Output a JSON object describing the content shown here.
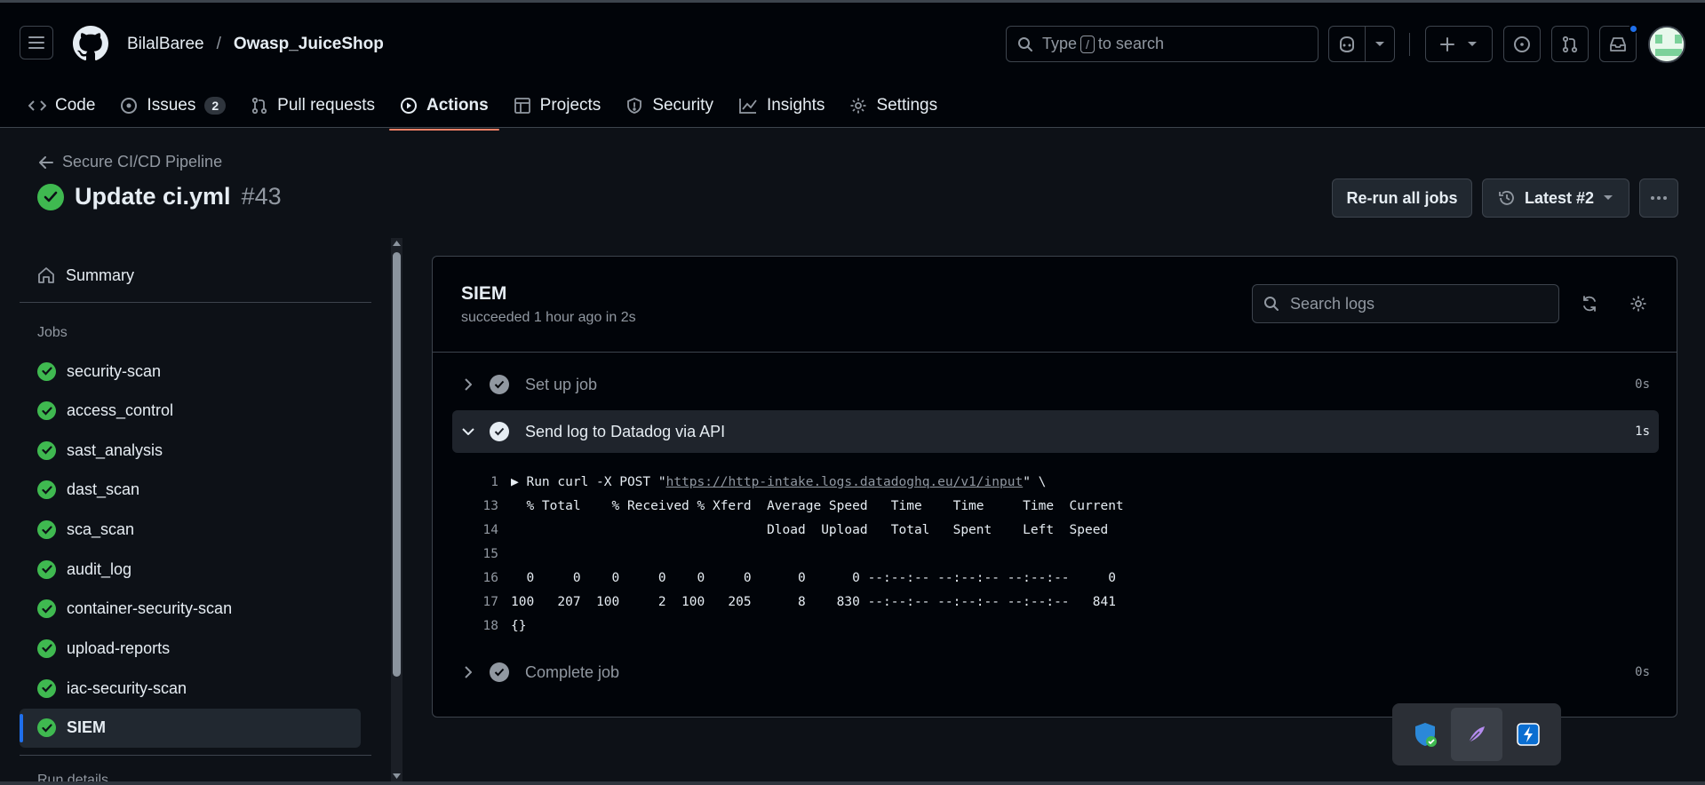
{
  "header": {
    "owner": "BilalBaree",
    "separator": "/",
    "repo": "Owasp_JuiceShop",
    "search_pre": "Type",
    "search_key": "/",
    "search_post": "to search"
  },
  "tabs": [
    {
      "label": "Code",
      "icon": "code-icon"
    },
    {
      "label": "Issues",
      "icon": "issue-icon",
      "count": "2"
    },
    {
      "label": "Pull requests",
      "icon": "pull-request-icon"
    },
    {
      "label": "Actions",
      "icon": "actions-play-icon",
      "active": true
    },
    {
      "label": "Projects",
      "icon": "table-icon"
    },
    {
      "label": "Security",
      "icon": "shield-icon"
    },
    {
      "label": "Insights",
      "icon": "graph-icon"
    },
    {
      "label": "Settings",
      "icon": "gear-icon"
    }
  ],
  "run": {
    "back_label": "Secure CI/CD Pipeline",
    "title": "Update ci.yml",
    "number": "#43",
    "rerun_label": "Re-run all jobs",
    "latest_label": "Latest #2"
  },
  "sidebar": {
    "summary_label": "Summary",
    "jobs_heading": "Jobs",
    "jobs": [
      {
        "name": "security-scan"
      },
      {
        "name": "access_control"
      },
      {
        "name": "sast_analysis"
      },
      {
        "name": "dast_scan"
      },
      {
        "name": "sca_scan"
      },
      {
        "name": "audit_log"
      },
      {
        "name": "container-security-scan"
      },
      {
        "name": "upload-reports"
      },
      {
        "name": "iac-security-scan"
      },
      {
        "name": "SIEM",
        "selected": true
      }
    ],
    "cut_off_text": "Run details"
  },
  "job": {
    "name": "SIEM",
    "status": "succeeded 1 hour ago in 2s",
    "search_placeholder": "Search logs",
    "steps": [
      {
        "name": "Set up job",
        "duration": "0s"
      },
      {
        "name": "Send log to Datadog via API",
        "duration": "1s",
        "expanded": true
      },
      {
        "name": "Complete job",
        "duration": "0s"
      }
    ],
    "log": [
      {
        "n": "1",
        "pre": "▶ Run curl -X POST \"",
        "link": "https://http-intake.logs.datadoghq.eu/v1/input",
        "post": "\" \\"
      },
      {
        "n": "13",
        "text": "  % Total    % Received % Xferd  Average Speed   Time    Time     Time  Current"
      },
      {
        "n": "14",
        "text": "                                 Dload  Upload   Total   Spent    Left  Speed"
      },
      {
        "n": "15",
        "text": ""
      },
      {
        "n": "16",
        "text": "  0     0    0     0    0     0      0      0 --:--:-- --:--:-- --:--:--     0"
      },
      {
        "n": "17",
        "text": "100   207  100     2  100   205      8    830 --:--:-- --:--:-- --:--:--   841"
      },
      {
        "n": "18",
        "text": "{}"
      }
    ]
  },
  "colors": {
    "success": "#3fb950",
    "accent_underline": "#f78166",
    "selected_bar": "#1f6feb"
  }
}
